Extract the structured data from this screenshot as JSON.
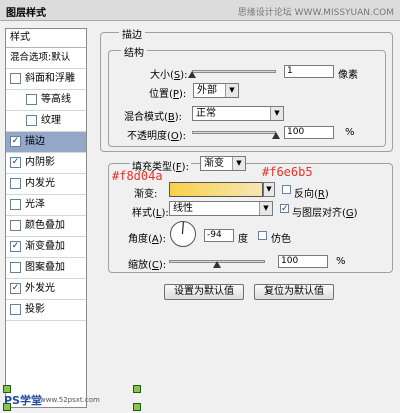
{
  "window": {
    "title": "图层样式",
    "watermark": "思缘设计论坛 WWW.MISSYUAN.COM"
  },
  "sidebar": {
    "header": "样式",
    "blend_options": "混合选项:默认",
    "items": [
      {
        "label": "斜面和浮雕",
        "checked": false,
        "indent": false,
        "selected": false
      },
      {
        "label": "等高线",
        "checked": false,
        "indent": true,
        "selected": false
      },
      {
        "label": "纹理",
        "checked": false,
        "indent": true,
        "selected": false
      },
      {
        "label": "描边",
        "checked": true,
        "indent": false,
        "selected": true
      },
      {
        "label": "内阴影",
        "checked": true,
        "indent": false,
        "selected": false
      },
      {
        "label": "内发光",
        "checked": false,
        "indent": false,
        "selected": false
      },
      {
        "label": "光泽",
        "checked": false,
        "indent": false,
        "selected": false
      },
      {
        "label": "颜色叠加",
        "checked": false,
        "indent": false,
        "selected": false
      },
      {
        "label": "渐变叠加",
        "checked": true,
        "indent": false,
        "selected": false
      },
      {
        "label": "图案叠加",
        "checked": false,
        "indent": false,
        "selected": false
      },
      {
        "label": "外发光",
        "checked": true,
        "indent": false,
        "selected": false
      },
      {
        "label": "投影",
        "checked": false,
        "indent": false,
        "selected": false
      }
    ],
    "logo": "PS学堂",
    "logo_url": "www.52psxt.com"
  },
  "stroke": {
    "section_title": "描边",
    "structure_title": "结构",
    "size_label": "大小",
    "size_key": "S",
    "size_value": "1",
    "size_unit": "像素",
    "size_level": 0.0,
    "position_label": "位置",
    "position_key": "P",
    "position_value": "外部",
    "blend_label": "混合模式",
    "blend_key": "B",
    "blend_value": "正常",
    "opacity_label": "不透明度",
    "opacity_key": "O",
    "opacity_value": "100",
    "opacity_unit": "%",
    "opacity_level": 1.0
  },
  "fill": {
    "type_label": "填充类型",
    "type_key": "F",
    "type_value": "渐变",
    "gradient_label": "渐变:",
    "reverse_label": "反向",
    "reverse_key": "R",
    "reverse_checked": false,
    "style_label": "样式",
    "style_key": "L",
    "style_value": "线性",
    "align_label": "与图层对齐",
    "align_key": "G",
    "align_checked": true,
    "angle_label": "角度",
    "angle_key": "A",
    "angle_value": "-94",
    "angle_unit": "度",
    "dither_label": "仿色",
    "dither_checked": false,
    "scale_label": "缩放",
    "scale_key": "C",
    "scale_value": "100",
    "scale_unit": "%",
    "scale_level": 0.5
  },
  "buttons": {
    "make_default": "设置为默认值",
    "reset_default": "复位为默认值"
  },
  "annotations": {
    "color_left": "#f8d04a",
    "color_right": "#f6e6b5"
  },
  "colors": {
    "gradient_start": "#f8d04a",
    "gradient_end": "#f6e6b5",
    "annotation": "#e8312a",
    "selected_row": "#93a7c8"
  }
}
